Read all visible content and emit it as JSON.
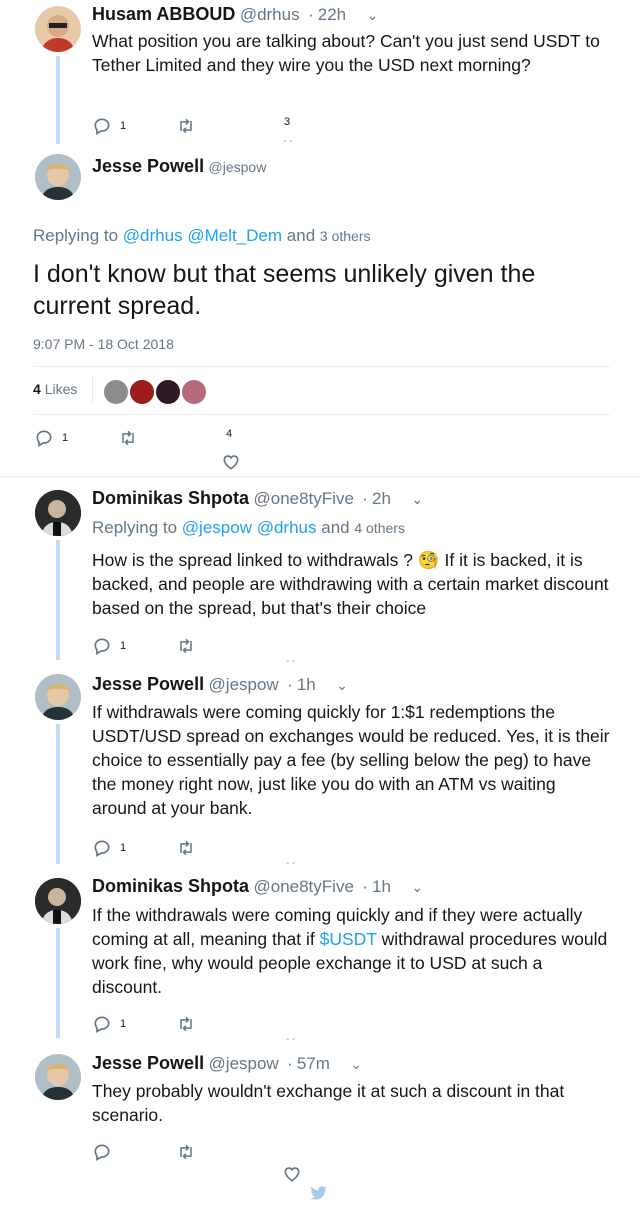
{
  "colors": {
    "accent": "#1da1f2",
    "muted": "#657786",
    "thread": "#c4dcf2"
  },
  "tweet1": {
    "name": "Husam ABBOUD",
    "handle": "@drhus",
    "sep": "·",
    "time": "22h",
    "caret": "⌄",
    "text": "What position you are talking about? Can't you just send USDT to Tether Limited and they wire you the USD next morning?",
    "reply_count": "1",
    "like_count": "3"
  },
  "main": {
    "name": "Jesse Powell",
    "handle": "@jespow",
    "replying_prefix": "Replying to",
    "mention1": "@drhus",
    "mention2": "@Melt_Dem",
    "and": "and",
    "others": "3 others",
    "text": "I don't know but that seems unlikely given the current spread.",
    "timestamp": "9:07 PM - 18 Oct 2018",
    "likes_count": "4",
    "likes_label": "Likes",
    "reply_count": "1",
    "like_count": "4"
  },
  "tweet3": {
    "name": "Dominikas Shpota",
    "handle": "@one8tyFive",
    "sep": "·",
    "time": "2h",
    "caret": "⌄",
    "replying_prefix": "Replying to",
    "mention1": "@jespow",
    "mention2": "@drhus",
    "and": "and",
    "others": "4 others",
    "text_a": "How is the spread linked to withdrawals ?",
    "emoji": "🧐",
    "text_b": "If it is backed, it is backed, and people are withdrawing with a certain market discount based on the spread, but that's their choice",
    "reply_count": "1"
  },
  "tweet4": {
    "name": "Jesse Powell",
    "handle": "@jespow",
    "sep": "·",
    "time": "1h",
    "caret": "⌄",
    "text": "If withdrawals were coming quickly for 1:$1 redemptions the USDT/USD spread on exchanges would be reduced. Yes, it is their choice to essentially pay a fee (by selling below the peg) to have the money right now, just like you do with an ATM vs waiting around at your bank.",
    "reply_count": "1"
  },
  "tweet5": {
    "name": "Dominikas Shpota",
    "handle": "@one8tyFive",
    "sep": "·",
    "time": "1h",
    "caret": "⌄",
    "text_a": "If the withdrawals were coming quickly and if they were actually coming at all, meaning that if",
    "cashtag": "$USDT",
    "text_b": "withdrawal procedures would work fine, why would people exchange it to USD at such a discount.",
    "reply_count": "1"
  },
  "tweet6": {
    "name": "Jesse Powell",
    "handle": "@jespow",
    "sep": "·",
    "time": "57m",
    "caret": "⌄",
    "text": "They probably wouldn't exchange it at such a discount in that scenario."
  },
  "misc": {
    "dashes": "- -"
  }
}
